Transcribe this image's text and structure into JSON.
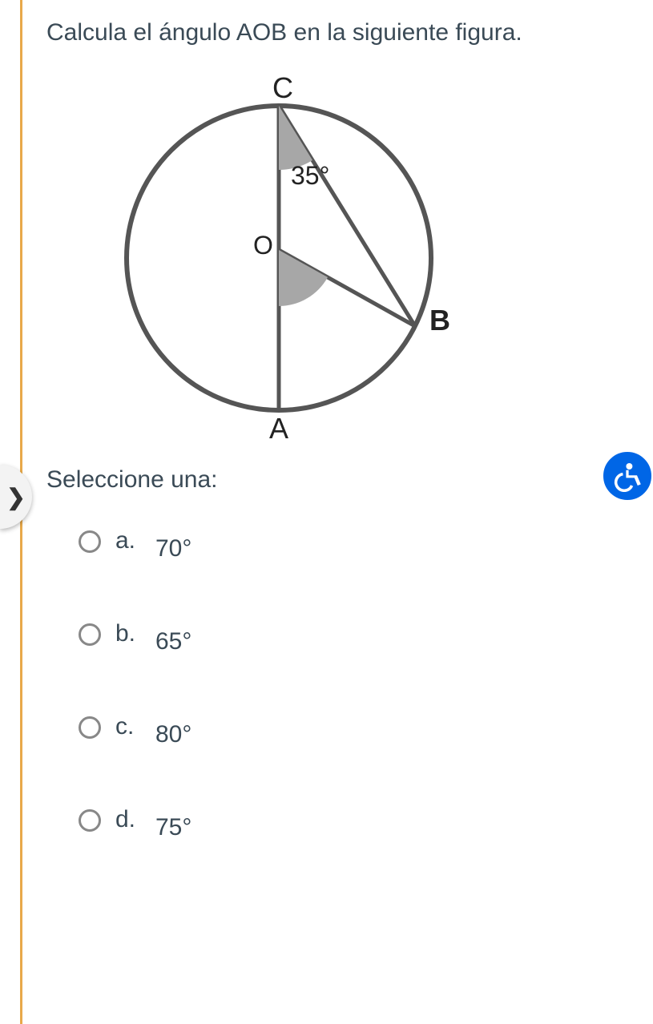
{
  "question": "Calcula el ángulo AOB en la siguiente figura.",
  "figure": {
    "labels": {
      "C": "C",
      "O": "O",
      "A": "A",
      "B": "B"
    },
    "angle_label": "35°"
  },
  "select_prompt": "Seleccione una:",
  "options": [
    {
      "letter": "a.",
      "value": "70°"
    },
    {
      "letter": "b.",
      "value": "65°"
    },
    {
      "letter": "c.",
      "value": "80°"
    },
    {
      "letter": "d.",
      "value": "75°"
    }
  ],
  "nav": {
    "arrow": "❯"
  }
}
